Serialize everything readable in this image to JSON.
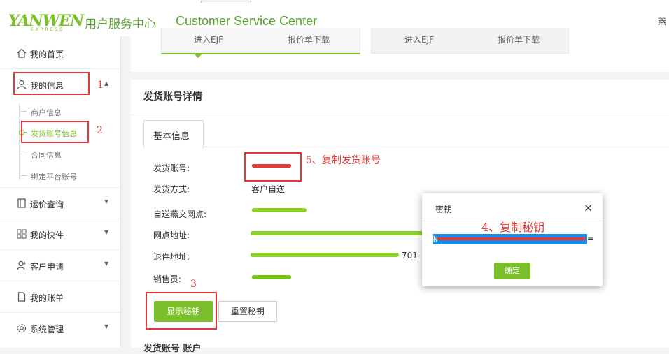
{
  "header": {
    "logo_text": "YANWEN",
    "logo_sub": "EXPRESS",
    "title_cn": "用户服务中心",
    "title_en": "Customer Service Center",
    "user_name": "燕"
  },
  "sidebar": {
    "items": [
      {
        "label": "我的首页",
        "icon": "home-icon"
      },
      {
        "label": "我的信息",
        "icon": "user-icon"
      },
      {
        "label": "运价查询",
        "icon": "document-icon"
      },
      {
        "label": "我的快件",
        "icon": "grid-icon"
      },
      {
        "label": "客户申请",
        "icon": "user-add-icon"
      },
      {
        "label": "我的账单",
        "icon": "file-icon"
      },
      {
        "label": "系统管理",
        "icon": "gear-icon"
      }
    ],
    "sub_items": [
      {
        "label": "商户信息"
      },
      {
        "label": "发货账号信息",
        "active": true
      },
      {
        "label": "合同信息"
      },
      {
        "label": "绑定平台账号"
      }
    ]
  },
  "top_tabs": [
    {
      "label_left": "进入EJF",
      "label_right": "报价单下载"
    },
    {
      "label_left": "进入EJF",
      "label_right": "报价单下载"
    }
  ],
  "section": {
    "title": "发货账号详情",
    "tab_label": "基本信息"
  },
  "fields": [
    {
      "label": "发货账号:",
      "value": ""
    },
    {
      "label": "发货方式:",
      "value": "客户自送"
    },
    {
      "label": "自送燕文网点:",
      "value": ""
    },
    {
      "label": "网点地址:",
      "value": ""
    },
    {
      "label": "退件地址:",
      "value": "701"
    },
    {
      "label": "销售员:",
      "value": ""
    }
  ],
  "buttons": {
    "show_key": "显示秘钥",
    "reset_key": "重置秘钥"
  },
  "annotations": {
    "step1": "1",
    "step2": "2",
    "step3": "3",
    "step4": "4、复制秘钥",
    "step5": "5、复制发货账号"
  },
  "modal": {
    "title": "密钥",
    "close": "×",
    "secret_visible": "N",
    "secret_end": "=",
    "ok": "确定"
  },
  "bottom_peek": "发货账号  账户"
}
